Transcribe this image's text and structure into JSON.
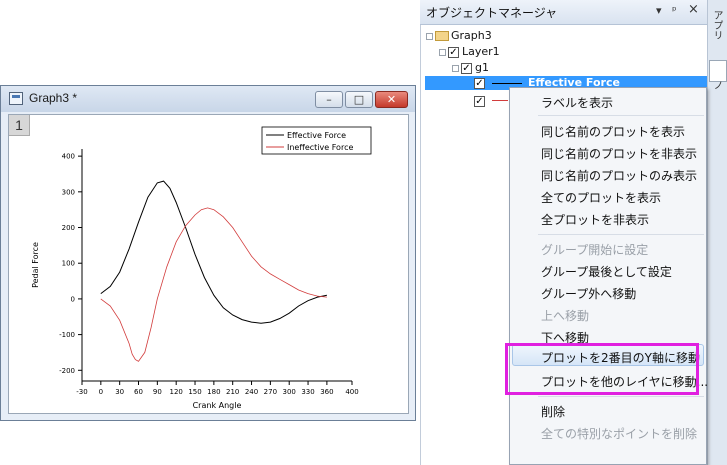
{
  "graph_window": {
    "title": "Graph3 *",
    "layer_label": "1",
    "minimize": "–",
    "maximize": "□",
    "close": "✕"
  },
  "object_manager": {
    "title": "オブジェクトマネージャ",
    "pin_icon": "▾",
    "dock_icon": "ᵖ",
    "close_icon": "×",
    "side_tab": "アプリ",
    "side_tab2": "ノ",
    "tree": {
      "graph": "Graph3",
      "layer": "Layer1",
      "group": "g1",
      "plot_selected": "Effective Force"
    }
  },
  "context_menu": {
    "items": [
      {
        "label": "ラベルを表示",
        "disabled": false
      },
      {
        "label": "同じ名前のプロットを表示",
        "disabled": false
      },
      {
        "label": "同じ名前のプロットを非表示",
        "disabled": false
      },
      {
        "label": "同じ名前のプロットのみ表示",
        "disabled": false
      },
      {
        "label": "全てのプロットを表示",
        "disabled": false
      },
      {
        "label": "全プロットを非表示",
        "disabled": false
      },
      {
        "label": "グループ開始に設定",
        "disabled": true
      },
      {
        "label": "グループ最後として設定",
        "disabled": false
      },
      {
        "label": "グループ外へ移動",
        "disabled": false
      },
      {
        "label": "上へ移動",
        "disabled": true
      },
      {
        "label": "下へ移動",
        "disabled": false
      },
      {
        "label": "プロットを2番目のY軸に移動",
        "disabled": false
      },
      {
        "label": "プロットを他のレイヤに移動...",
        "disabled": false
      },
      {
        "label": "削除",
        "disabled": false
      },
      {
        "label": "全ての特別なポイントを削除",
        "disabled": true
      }
    ]
  },
  "colors": {
    "highlight_box": "#e020e0",
    "selection": "#3399ff",
    "series_effective": "#000000",
    "series_ineffective": "#d23c3c"
  },
  "chart_data": {
    "type": "line",
    "xlabel": "Crank Angle",
    "ylabel": "Pedal Force",
    "xlim": [
      -30,
      400
    ],
    "ylim": [
      -230,
      420
    ],
    "xticks": [
      -30,
      0,
      30,
      60,
      90,
      120,
      150,
      180,
      210,
      240,
      270,
      300,
      330,
      360,
      400
    ],
    "yticks": [
      -200,
      -100,
      0,
      100,
      200,
      300,
      400
    ],
    "legend_position": "top-right",
    "series": [
      {
        "name": "Effective Force",
        "color": "#000000",
        "x": [
          0,
          15,
          30,
          45,
          60,
          75,
          90,
          100,
          110,
          120,
          135,
          150,
          165,
          180,
          195,
          210,
          225,
          240,
          255,
          270,
          285,
          300,
          315,
          330,
          345,
          360
        ],
        "y": [
          15,
          35,
          75,
          140,
          215,
          285,
          325,
          330,
          310,
          270,
          200,
          125,
          60,
          10,
          -25,
          -45,
          -58,
          -65,
          -68,
          -65,
          -55,
          -40,
          -20,
          -5,
          5,
          10
        ]
      },
      {
        "name": "Ineffective Force",
        "color": "#d23c3c",
        "x": [
          0,
          15,
          30,
          45,
          50,
          55,
          60,
          70,
          80,
          90,
          105,
          120,
          135,
          150,
          160,
          170,
          180,
          195,
          210,
          225,
          240,
          255,
          270,
          285,
          300,
          315,
          330,
          345,
          360
        ],
        "y": [
          0,
          -20,
          -60,
          -125,
          -155,
          -170,
          -175,
          -150,
          -80,
          0,
          90,
          160,
          205,
          235,
          250,
          255,
          250,
          230,
          200,
          160,
          120,
          90,
          70,
          55,
          40,
          25,
          15,
          8,
          5
        ]
      }
    ]
  }
}
